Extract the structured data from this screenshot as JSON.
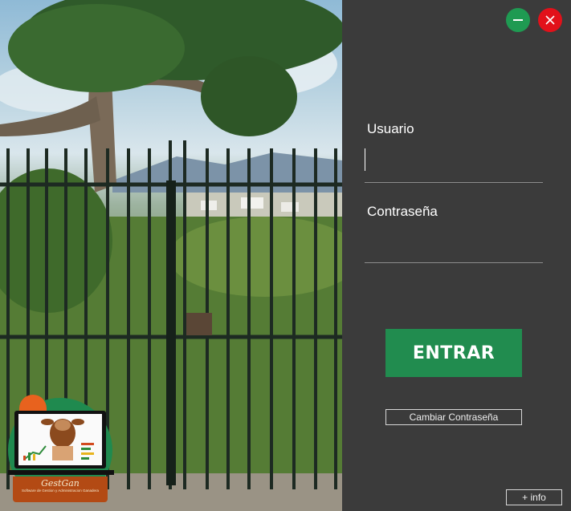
{
  "window": {
    "minimize_icon": "minus-icon",
    "close_icon": "close-icon",
    "minimize_color": "#1f9a52",
    "close_color": "#e2111a"
  },
  "login": {
    "username_label": "Usuario",
    "username_value": "",
    "password_label": "Contraseña",
    "password_value": "",
    "enter_label": "ENTRAR",
    "change_password_label": "Cambiar Contraseña",
    "info_label": "+ info",
    "accent": "#218c4f"
  },
  "logo": {
    "brand": "GestGan",
    "tagline": "Software de Gestion y Administracion Ganadera"
  }
}
